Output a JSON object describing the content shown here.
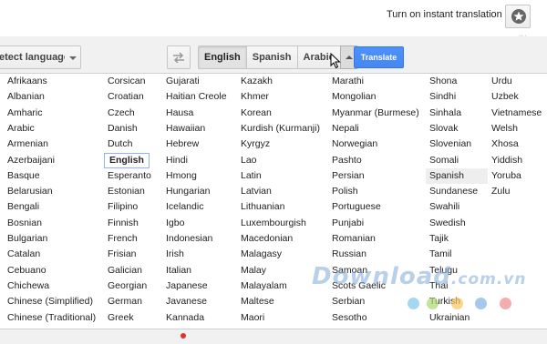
{
  "header": {
    "instant_link": "Turn on instant translation",
    "star_icon": "star-icon",
    "corner_mark": "g+"
  },
  "toolbar": {
    "source_button": "etect language",
    "swap_icon": "swap-arrows-icon",
    "targets": [
      "English",
      "Spanish",
      "Arabic"
    ],
    "selected_target": "English",
    "translate_label": "Translate",
    "accent_color": "#4d90fe"
  },
  "menu": {
    "selected": "English",
    "hover": "Spanish",
    "columns": [
      [
        "Afrikaans",
        "Albanian",
        "Amharic",
        "Arabic",
        "Armenian",
        "Azerbaijani",
        "Basque",
        "Belarusian",
        "Bengali",
        "Bosnian",
        "Bulgarian",
        "Catalan",
        "Cebuano",
        "Chichewa",
        "Chinese (Simplified)",
        "Chinese (Traditional)"
      ],
      [
        "Corsican",
        "Croatian",
        "Czech",
        "Danish",
        "Dutch",
        "English",
        "Esperanto",
        "Estonian",
        "Filipino",
        "Finnish",
        "French",
        "Frisian",
        "Galician",
        "Georgian",
        "German",
        "Greek"
      ],
      [
        "Gujarati",
        "Haitian Creole",
        "Hausa",
        "Hawaiian",
        "Hebrew",
        "Hindi",
        "Hmong",
        "Hungarian",
        "Icelandic",
        "Igbo",
        "Indonesian",
        "Irish",
        "Italian",
        "Japanese",
        "Javanese",
        "Kannada"
      ],
      [
        "Kazakh",
        "Khmer",
        "Korean",
        "Kurdish (Kurmanji)",
        "Kyrgyz",
        "Lao",
        "Latin",
        "Latvian",
        "Lithuanian",
        "Luxembourgish",
        "Macedonian",
        "Malagasy",
        "Malay",
        "Malayalam",
        "Maltese",
        "Maori"
      ],
      [
        "Marathi",
        "Mongolian",
        "Myanmar (Burmese)",
        "Nepali",
        "Norwegian",
        "Pashto",
        "Persian",
        "Polish",
        "Portuguese",
        "Punjabi",
        "Romanian",
        "Russian",
        "Samoan",
        "Scots Gaelic",
        "Serbian",
        "Sesotho"
      ],
      [
        "Shona",
        "Sindhi",
        "Sinhala",
        "Slovak",
        "Slovenian",
        "Somali",
        "Spanish",
        "Sundanese",
        "Swahili",
        "Swedish",
        "Tajik",
        "Tamil",
        "Telugu",
        "Thai",
        "Turkish",
        "Ukrainian"
      ],
      [
        "Urdu",
        "Uzbek",
        "Vietnamese",
        "Welsh",
        "Xhosa",
        "Yiddish",
        "Yoruba",
        "Zulu"
      ]
    ]
  },
  "watermark": {
    "brand": "Download",
    "domain": ".com.vn",
    "dot_colors": [
      "#7fc8ea",
      "#a9d66f",
      "#f6c65a",
      "#7fb0e6",
      "#f08a8a"
    ]
  }
}
